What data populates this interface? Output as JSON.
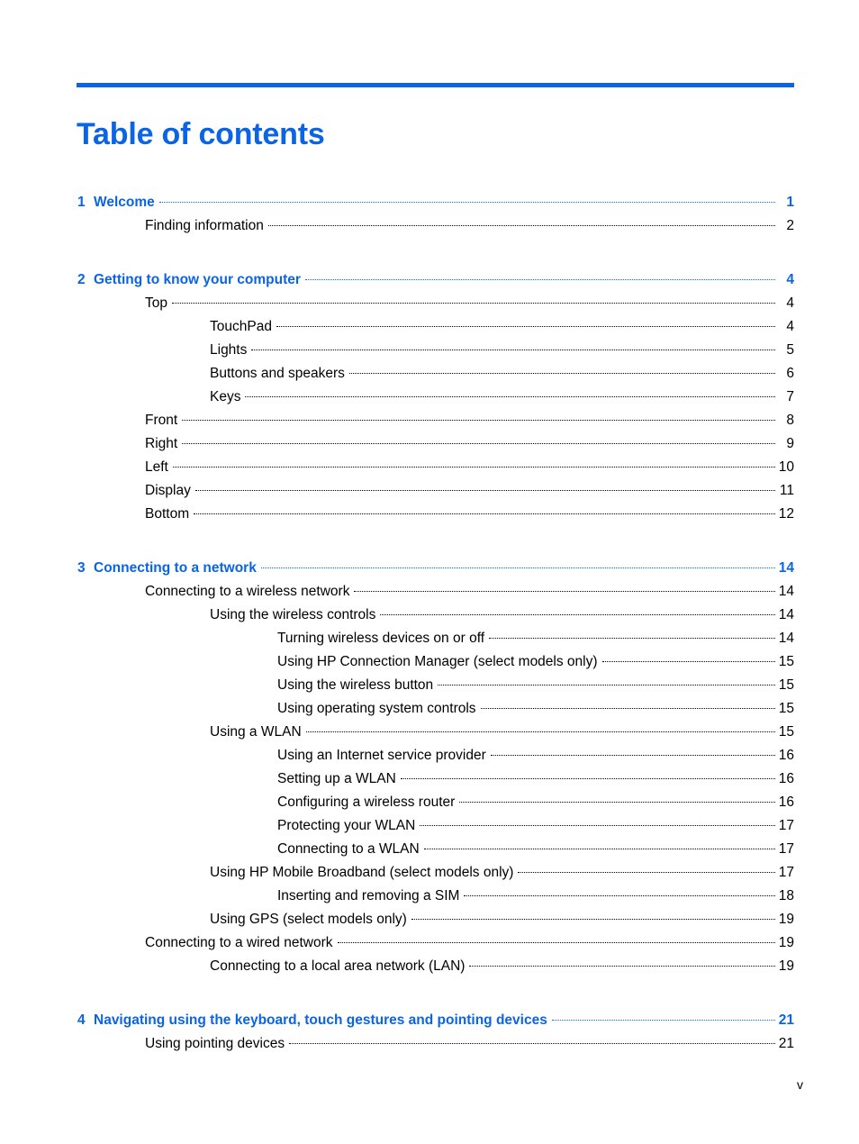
{
  "document": {
    "title": "Table of contents",
    "folio": "v",
    "accent_color": "#0a64e4",
    "text_color": "#000000"
  },
  "toc": {
    "groups": [
      {
        "chapter": {
          "number": "1",
          "label": "Welcome",
          "page": "1",
          "level": 0
        },
        "entries": [
          {
            "label": "Finding information",
            "page": "2",
            "level": 1
          }
        ]
      },
      {
        "chapter": {
          "number": "2",
          "label": "Getting to know your computer",
          "page": "4",
          "level": 0
        },
        "entries": [
          {
            "label": "Top",
            "page": "4",
            "level": 1
          },
          {
            "label": "TouchPad",
            "page": "4",
            "level": 2
          },
          {
            "label": "Lights",
            "page": "5",
            "level": 2
          },
          {
            "label": "Buttons and speakers",
            "page": "6",
            "level": 2
          },
          {
            "label": "Keys",
            "page": "7",
            "level": 2
          },
          {
            "label": "Front",
            "page": "8",
            "level": 1
          },
          {
            "label": "Right",
            "page": "9",
            "level": 1
          },
          {
            "label": "Left",
            "page": "10",
            "level": 1
          },
          {
            "label": "Display",
            "page": "11",
            "level": 1
          },
          {
            "label": "Bottom",
            "page": "12",
            "level": 1
          }
        ]
      },
      {
        "chapter": {
          "number": "3",
          "label": "Connecting to a network",
          "page": "14",
          "level": 0
        },
        "entries": [
          {
            "label": "Connecting to a wireless network",
            "page": "14",
            "level": 1
          },
          {
            "label": "Using the wireless controls",
            "page": "14",
            "level": 2
          },
          {
            "label": "Turning wireless devices on or off",
            "page": "14",
            "level": 3
          },
          {
            "label": "Using HP Connection Manager (select models only)",
            "page": "15",
            "level": 3
          },
          {
            "label": "Using the wireless button",
            "page": "15",
            "level": 3
          },
          {
            "label": "Using operating system controls",
            "page": "15",
            "level": 3
          },
          {
            "label": "Using a WLAN",
            "page": "15",
            "level": 2
          },
          {
            "label": "Using an Internet service provider",
            "page": "16",
            "level": 3
          },
          {
            "label": "Setting up a WLAN",
            "page": "16",
            "level": 3
          },
          {
            "label": "Configuring a wireless router",
            "page": "16",
            "level": 3
          },
          {
            "label": "Protecting your WLAN",
            "page": "17",
            "level": 3
          },
          {
            "label": "Connecting to a WLAN",
            "page": "17",
            "level": 3
          },
          {
            "label": "Using HP Mobile Broadband (select models only)",
            "page": "17",
            "level": 2
          },
          {
            "label": "Inserting and removing a SIM",
            "page": "18",
            "level": 3
          },
          {
            "label": "Using GPS (select models only)",
            "page": "19",
            "level": 2
          },
          {
            "label": "Connecting to a wired network",
            "page": "19",
            "level": 1
          },
          {
            "label": "Connecting to a local area network (LAN)",
            "page": "19",
            "level": 2
          }
        ]
      },
      {
        "chapter": {
          "number": "4",
          "label": "Navigating using the keyboard, touch gestures and pointing devices",
          "page": "21",
          "level": 0
        },
        "entries": [
          {
            "label": "Using pointing devices",
            "page": "21",
            "level": 1
          }
        ]
      }
    ]
  }
}
